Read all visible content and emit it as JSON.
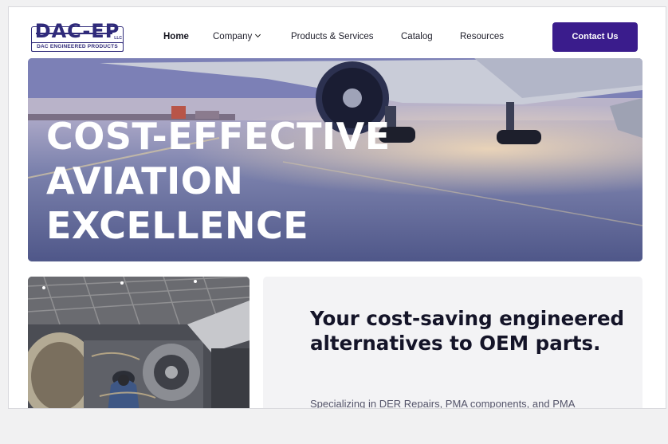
{
  "logo": {
    "main": "DAC-EP",
    "llc": "LLC",
    "sub": "DAC ENGINEERED PRODUCTS"
  },
  "nav": {
    "items": [
      {
        "label": "Home"
      },
      {
        "label": "Company"
      },
      {
        "label": "Products & Services"
      },
      {
        "label": "Catalog"
      },
      {
        "label": "Resources"
      }
    ],
    "cta": "Contact Us"
  },
  "hero": {
    "lines": [
      "COST-EFFECTIVE",
      "AVIATION",
      "EXCELLENCE"
    ],
    "image_icon": "airplane-on-tarmac"
  },
  "section": {
    "image_icon": "jet-engine-hangar",
    "heading": "Your cost-saving engineered alternatives to OEM parts.",
    "text": "Specializing in DER Repairs, PMA components, and PMA"
  },
  "colors": {
    "accent": "#3a1c8c",
    "brand": "#2f2a7a",
    "panel": "#f3f3f5"
  }
}
